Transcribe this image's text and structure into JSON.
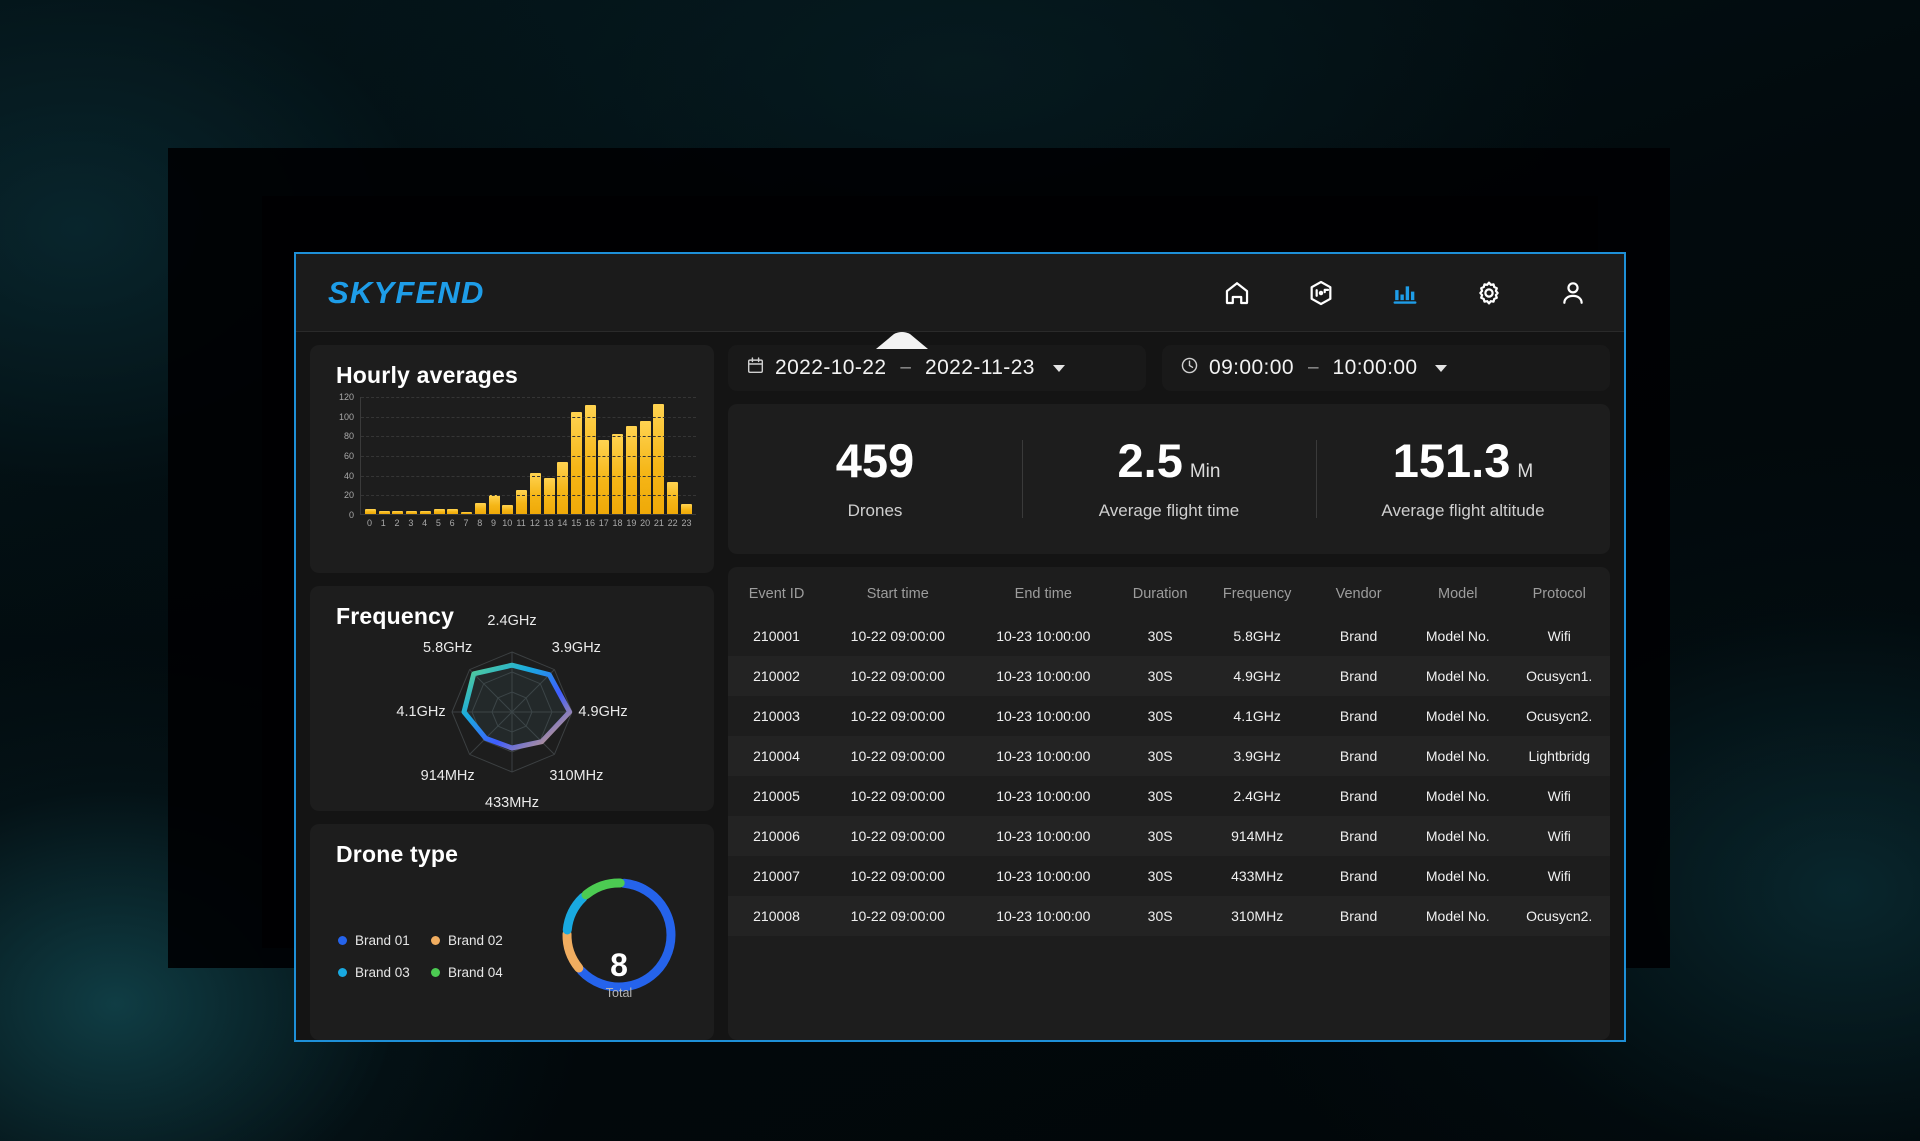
{
  "header": {
    "brand": "SKYFEND",
    "nav": [
      {
        "name": "home-icon",
        "label": "Home",
        "active": false
      },
      {
        "name": "drone-detect-icon",
        "label": "Detection",
        "active": false
      },
      {
        "name": "bar-chart-icon",
        "label": "Statistics",
        "active": true
      },
      {
        "name": "gear-icon",
        "label": "Settings",
        "active": false
      },
      {
        "name": "user-icon",
        "label": "Account",
        "active": false
      }
    ],
    "active_color": "#1e9de8",
    "icon_color": "#ffffff"
  },
  "filters": {
    "date": {
      "icon": "calendar-icon",
      "start": "2022-10-22",
      "separator": "–",
      "end": "2022-11-23"
    },
    "time": {
      "icon": "clock-icon",
      "start": "09:00:00",
      "separator": "–",
      "end": "10:00:00"
    },
    "collapse_handle": "collapse-chevron"
  },
  "kpis": [
    {
      "value": "459",
      "unit": "",
      "label": "Drones"
    },
    {
      "value": "2.5",
      "unit": "Min",
      "label": "Average flight time"
    },
    {
      "value": "151.3",
      "unit": "M",
      "label": "Average flight altitude"
    }
  ],
  "panels": {
    "hourly_title": "Hourly averages",
    "frequency_title": "Frequency",
    "drone_type_title": "Drone type"
  },
  "drone_type": {
    "total_value": "8",
    "total_label": "Total",
    "legend": [
      {
        "label": "Brand 01",
        "color": "#2563eb"
      },
      {
        "label": "Brand 02",
        "color": "#f0ad60"
      },
      {
        "label": "Brand 03",
        "color": "#19a9e0"
      },
      {
        "label": "Brand 04",
        "color": "#4ccb52"
      }
    ]
  },
  "table": {
    "columns": [
      "Event ID",
      "Start time",
      "End time",
      "Duration",
      "Frequency",
      "Vendor",
      "Model",
      "Protocol"
    ],
    "rows": [
      [
        "210001",
        "10-22 09:00:00",
        "10-23 10:00:00",
        "30S",
        "5.8GHz",
        "Brand",
        "Model No.",
        "Wifi"
      ],
      [
        "210002",
        "10-22 09:00:00",
        "10-23 10:00:00",
        "30S",
        "4.9GHz",
        "Brand",
        "Model No.",
        "Ocusycn1."
      ],
      [
        "210003",
        "10-22 09:00:00",
        "10-23 10:00:00",
        "30S",
        "4.1GHz",
        "Brand",
        "Model No.",
        "Ocusycn2."
      ],
      [
        "210004",
        "10-22 09:00:00",
        "10-23 10:00:00",
        "30S",
        "3.9GHz",
        "Brand",
        "Model No.",
        "Lightbridg"
      ],
      [
        "210005",
        "10-22 09:00:00",
        "10-23 10:00:00",
        "30S",
        "2.4GHz",
        "Brand",
        "Model No.",
        "Wifi"
      ],
      [
        "210006",
        "10-22 09:00:00",
        "10-23 10:00:00",
        "30S",
        "914MHz",
        "Brand",
        "Model No.",
        "Wifi"
      ],
      [
        "210007",
        "10-22 09:00:00",
        "10-23 10:00:00",
        "30S",
        "433MHz",
        "Brand",
        "Model No.",
        "Wifi"
      ],
      [
        "210008",
        "10-22 09:00:00",
        "10-23 10:00:00",
        "30S",
        "310MHz",
        "Brand",
        "Model No.",
        "Ocusycn2."
      ]
    ]
  },
  "chart_data": [
    {
      "type": "bar",
      "title": "Hourly averages",
      "xlabel": "",
      "ylabel": "",
      "categories": [
        "0",
        "1",
        "2",
        "3",
        "4",
        "5",
        "6",
        "7",
        "8",
        "9",
        "10",
        "11",
        "12",
        "13",
        "14",
        "15",
        "16",
        "17",
        "18",
        "19",
        "20",
        "21",
        "22",
        "23"
      ],
      "values": [
        5,
        3,
        3,
        3,
        3,
        5,
        5,
        2,
        11,
        19,
        9,
        24,
        42,
        37,
        53,
        104,
        111,
        75,
        81,
        89,
        95,
        112,
        33,
        10
      ],
      "ylim": [
        0,
        120
      ],
      "yticks": [
        0,
        20,
        40,
        60,
        80,
        100,
        120
      ],
      "grid": true,
      "bar_color": "#f5b617"
    },
    {
      "type": "radar",
      "title": "Frequency",
      "categories": [
        "2.4GHz",
        "3.9GHz",
        "4.9GHz",
        "310MHz",
        "433MHz",
        "914MHz",
        "4.1GHz",
        "5.8GHz"
      ],
      "values": [
        0.78,
        0.88,
        0.96,
        0.7,
        0.6,
        0.62,
        0.8,
        0.9
      ],
      "rings": 3,
      "grid": true,
      "gradient": [
        "#5fd38a",
        "#19a9e0",
        "#3f5dff",
        "#f0ad60"
      ]
    },
    {
      "type": "pie",
      "title": "Drone type",
      "subtype": "donut",
      "categories": [
        "Brand 01",
        "Brand 02",
        "Brand 03",
        "Brand 04"
      ],
      "values": [
        5,
        1,
        1,
        1
      ],
      "percent": [
        62.5,
        12.5,
        12.5,
        12.5
      ],
      "colors": [
        "#2563eb",
        "#f0ad60",
        "#19a9e0",
        "#4ccb52"
      ],
      "center_value": "8",
      "center_label": "Total",
      "legend": "left"
    }
  ]
}
